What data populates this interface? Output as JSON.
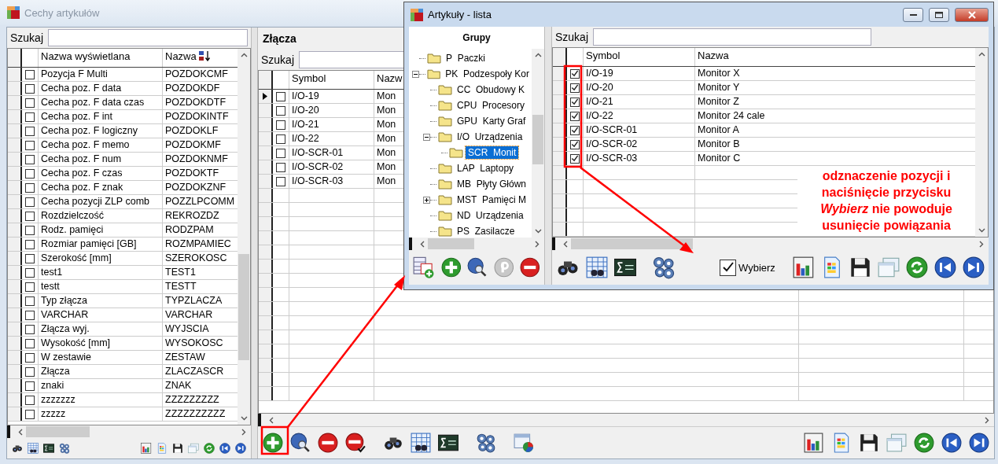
{
  "window": {
    "title": "Cechy artykułów"
  },
  "features": {
    "search_label": "Szukaj",
    "columns": [
      "Nazwa wyświetlana",
      "Nazwa"
    ],
    "rows": [
      {
        "checked": false,
        "display_name": "Pozycja F Multi",
        "name": "POZDOKCMF"
      },
      {
        "checked": false,
        "display_name": "Cecha poz. F data",
        "name": "POZDOKDF"
      },
      {
        "checked": false,
        "display_name": "Cecha poz. F data czas",
        "name": "POZDOKDTF"
      },
      {
        "checked": false,
        "display_name": "Cecha poz. F int",
        "name": "POZDOKINTF"
      },
      {
        "checked": false,
        "display_name": "Cecha poz. F logiczny",
        "name": "POZDOKLF"
      },
      {
        "checked": false,
        "display_name": "Cecha poz. F memo",
        "name": "POZDOKMF"
      },
      {
        "checked": false,
        "display_name": "Cecha poz. F num",
        "name": "POZDOKNMF"
      },
      {
        "checked": false,
        "display_name": "Cecha poz. F czas",
        "name": "POZDOKTF"
      },
      {
        "checked": false,
        "display_name": "Cecha poz. F znak",
        "name": "POZDOKZNF"
      },
      {
        "checked": false,
        "display_name": "Cecha pozycji ZLP comb",
        "name": "POZZLPCOMM"
      },
      {
        "checked": false,
        "display_name": "Rozdzielczość",
        "name": "REKROZDZ"
      },
      {
        "checked": false,
        "display_name": "Rodz. pamięci",
        "name": "RODZPAM"
      },
      {
        "checked": false,
        "display_name": "Rozmiar pamięci [GB]",
        "name": "ROZMPAMIEC"
      },
      {
        "checked": false,
        "display_name": "Szerokość [mm]",
        "name": "SZEROKOSC"
      },
      {
        "checked": false,
        "display_name": "test1",
        "name": "TEST1"
      },
      {
        "checked": false,
        "display_name": "testt",
        "name": "TESTT"
      },
      {
        "checked": false,
        "display_name": "Typ złącza",
        "name": "TYPZLACZA"
      },
      {
        "checked": false,
        "display_name": "VARCHAR",
        "name": "VARCHAR"
      },
      {
        "checked": false,
        "display_name": "Złącza wyj.",
        "name": "WYJSCIA"
      },
      {
        "checked": false,
        "display_name": "Wysokość [mm]",
        "name": "WYSOKOSC"
      },
      {
        "checked": false,
        "display_name": "W zestawie",
        "name": "ZESTAW"
      },
      {
        "checked": false,
        "display_name": "Złącza",
        "name": "ZLACZASCR"
      },
      {
        "checked": false,
        "display_name": "znaki",
        "name": "ZNAK"
      },
      {
        "checked": false,
        "display_name": "zzzzzzz",
        "name": "ZZZZZZZZZ"
      },
      {
        "checked": false,
        "display_name": "zzzzz",
        "name": "ZZZZZZZZZZ"
      }
    ]
  },
  "connectors": {
    "title": "Złącza",
    "search_label": "Szukaj",
    "columns": [
      "Symbol",
      "Nazw"
    ],
    "rows": [
      {
        "current": true,
        "checked": false,
        "symbol": "I/O-19",
        "name": "Mon"
      },
      {
        "current": false,
        "checked": false,
        "symbol": "I/O-20",
        "name": "Mon"
      },
      {
        "current": false,
        "checked": false,
        "symbol": "I/O-21",
        "name": "Mon"
      },
      {
        "current": false,
        "checked": false,
        "symbol": "I/O-22",
        "name": "Mon"
      },
      {
        "current": false,
        "checked": false,
        "symbol": "I/O-SCR-01",
        "name": "Mon"
      },
      {
        "current": false,
        "checked": false,
        "symbol": "I/O-SCR-02",
        "name": "Mon"
      },
      {
        "current": false,
        "checked": false,
        "symbol": "I/O-SCR-03",
        "name": "Mon"
      }
    ]
  },
  "popup": {
    "title": "Artykuły - lista",
    "groups_title": "Grupy",
    "tree": [
      {
        "code": "P",
        "name": "Paczki",
        "selected": false
      },
      {
        "code": "PK",
        "name": "Podzespoły Kor",
        "selected": false,
        "expanded": true,
        "children": [
          {
            "code": "CC",
            "name": "Obudowy K",
            "selected": false
          },
          {
            "code": "CPU",
            "name": "Procesory",
            "selected": false
          },
          {
            "code": "GPU",
            "name": "Karty Graf",
            "selected": false
          },
          {
            "code": "I/O",
            "name": "Urządzenia",
            "selected": false,
            "expanded": true,
            "children": [
              {
                "code": "SCR",
                "name": "Monit",
                "selected": true
              }
            ]
          },
          {
            "code": "LAP",
            "name": "Laptopy",
            "selected": false
          },
          {
            "code": "MB",
            "name": "Płyty Główn",
            "selected": false
          },
          {
            "code": "MST",
            "name": "Pamięci M",
            "selected": false,
            "expanded": false
          },
          {
            "code": "ND",
            "name": "Urządzenia",
            "selected": false
          },
          {
            "code": "PS",
            "name": "Zasilacze",
            "selected": false
          }
        ]
      }
    ],
    "search_label": "Szukaj",
    "columns": [
      "Symbol",
      "Nazwa"
    ],
    "rows": [
      {
        "checked": true,
        "symbol": "I/O-19",
        "name": "Monitor X"
      },
      {
        "checked": true,
        "symbol": "I/O-20",
        "name": "Monitor Y"
      },
      {
        "checked": true,
        "symbol": "I/O-21",
        "name": "Monitor Z"
      },
      {
        "checked": true,
        "symbol": "I/O-22",
        "name": "Monitor 24 cale"
      },
      {
        "checked": true,
        "symbol": "I/O-SCR-01",
        "name": "Monitor A"
      },
      {
        "checked": true,
        "symbol": "I/O-SCR-02",
        "name": "Monitor B"
      },
      {
        "checked": true,
        "symbol": "I/O-SCR-03",
        "name": "Monitor C"
      }
    ],
    "select_checkbox": {
      "label": "Wybierz",
      "checked": true
    }
  },
  "annotation": {
    "text": "odznaczenie pozycji i naciśnięcie przycisku *Wybierz* nie powoduje usunięcie powiązania"
  }
}
